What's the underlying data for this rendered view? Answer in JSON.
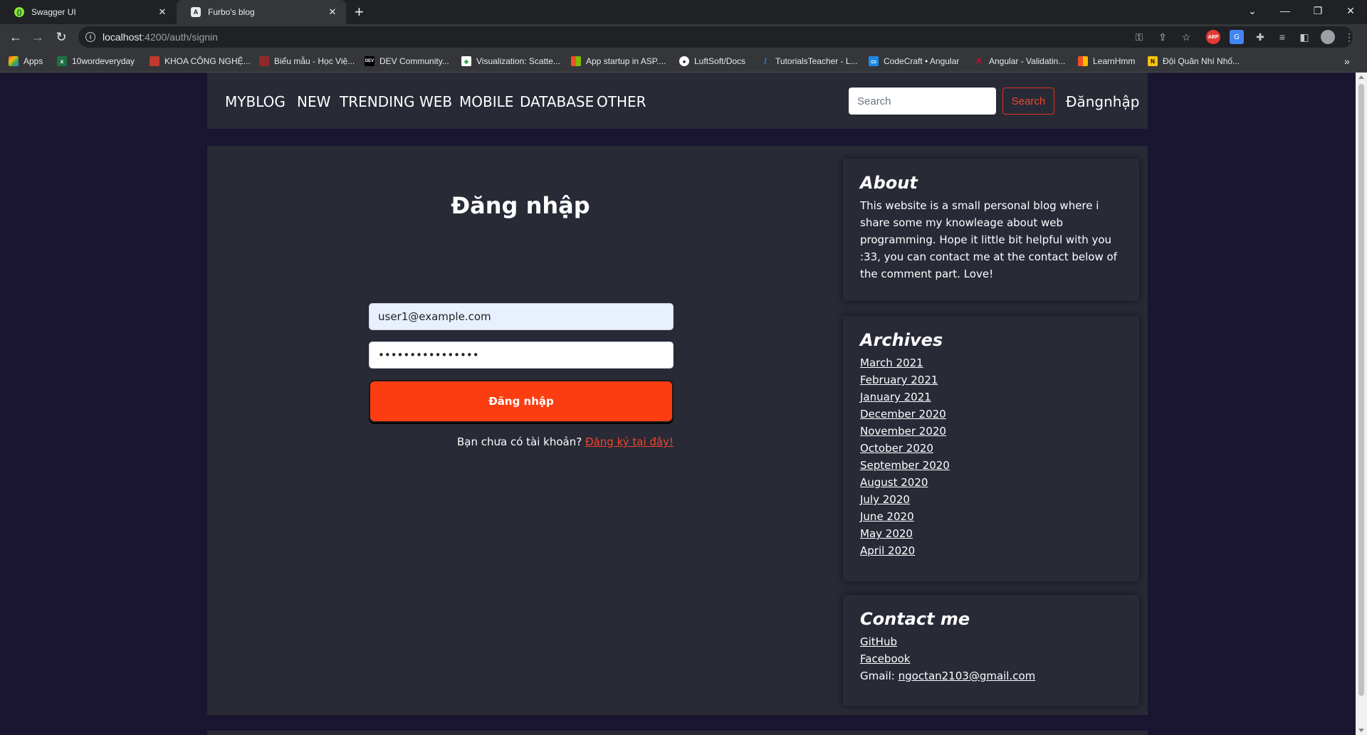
{
  "browser": {
    "tabs": [
      {
        "title": "Swagger UI",
        "active": false
      },
      {
        "title": "Furbo's blog",
        "active": true
      }
    ],
    "url_host": "localhost",
    "url_path": ":4200/auth/signin",
    "bookmarks": [
      {
        "label": "Apps",
        "color": "#e8453c"
      },
      {
        "label": "10wordeveryday",
        "color": "#1e7145"
      },
      {
        "label": "KHOA CÔNG NGHỆ...",
        "color": "#c0392b"
      },
      {
        "label": "Biểu mẫu - Học Việ...",
        "color": "#8e2a2a"
      },
      {
        "label": "DEV Community...",
        "color": "#000000"
      },
      {
        "label": "Visualization: Scatte...",
        "color": "#34a853"
      },
      {
        "label": "App startup in ASP....",
        "color": "#f25022"
      },
      {
        "label": "LuftSoft/Docs",
        "color": "#ffffff"
      },
      {
        "label": "TutorialsTeacher - L...",
        "color": "#1565c0"
      },
      {
        "label": "CodeCraft • Angular",
        "color": "#1e88e5"
      },
      {
        "label": "Angular - Validatin...",
        "color": "#dd0031"
      },
      {
        "label": "LearnHmm",
        "color": "#f25022"
      },
      {
        "label": "Đội Quân Nhí Nhố...",
        "color": "#f4c20d"
      }
    ],
    "more_bookmarks": "»"
  },
  "nav": {
    "brand": "MYBLOG",
    "items": [
      "NEW",
      "TRENDING",
      "WEB",
      "MOBILE",
      "DATABASE",
      "OTHER"
    ],
    "search_placeholder": "Search",
    "search_button": "Search",
    "login": "Đăngnhập"
  },
  "signin": {
    "title": "Đăng nhập",
    "email_value": "user1@example.com",
    "password_value": "••••••••••••••••",
    "submit_label": "Đăng nhập",
    "signup_prompt": "Bạn chưa có tài khoản?",
    "signup_link": "Đăng ký tại đây!"
  },
  "sidebar": {
    "about": {
      "title": "About",
      "text": "This website is a small personal blog where i share some my knowleage about web programming. Hope it little bit helpful with you :33, you can contact me at the contact below of the comment part. Love!"
    },
    "archives": {
      "title": "Archives",
      "items": [
        "March 2021",
        "February 2021",
        "January 2021",
        "December 2020",
        "November 2020",
        "October 2020",
        "September 2020",
        "August 2020",
        "July 2020",
        "June 2020",
        "May 2020",
        "April 2020"
      ]
    },
    "contact": {
      "title": "Contact me",
      "github": "GitHub",
      "facebook": "Facebook",
      "gmail_label": "Gmail:",
      "gmail_value": "ngoctan2103@gmail.com"
    }
  },
  "colors": {
    "page_bg": "#1a1530",
    "panel_bg": "#282a36",
    "accent": "#fc3d12"
  }
}
